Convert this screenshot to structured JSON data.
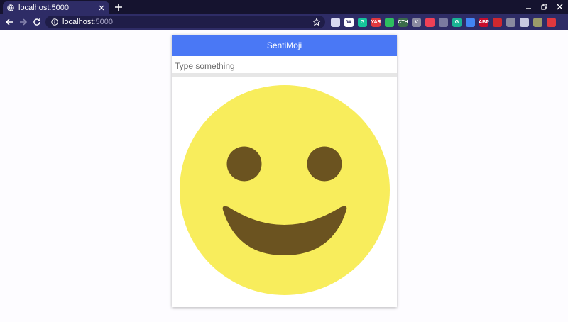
{
  "browser": {
    "tab": {
      "title": "localhost:5000"
    },
    "address": {
      "host": "localhost",
      "port": ":5000"
    },
    "extensions": [
      {
        "icon": "circle-ext-icon",
        "label": "",
        "color": "#d9d9f0"
      },
      {
        "icon": "w-ext-icon",
        "label": "W",
        "color": "#ffffff"
      },
      {
        "icon": "grammarly-ext-icon",
        "label": "G",
        "color": "#15c39a"
      },
      {
        "icon": "yar-ext-icon",
        "label": "YAR",
        "color": "#e0383e"
      },
      {
        "icon": "evernote-ext-icon",
        "label": "",
        "color": "#2dbe60"
      },
      {
        "icon": "cth-ext-icon",
        "label": "CTH",
        "color": "#3a6b4a"
      },
      {
        "icon": "v-ext-icon",
        "label": "V",
        "color": "#8a8aa0"
      },
      {
        "icon": "pocket-ext-icon",
        "label": "",
        "color": "#ef4056"
      },
      {
        "icon": "cast-ext-icon",
        "label": "",
        "color": "#7a7aa0"
      },
      {
        "icon": "translate-ext-icon",
        "label": "G",
        "color": "#1ab394"
      },
      {
        "icon": "refresh-ext-icon",
        "label": "",
        "color": "#4285f4"
      },
      {
        "icon": "abp-ext-icon",
        "label": "ABP",
        "color": "#c70d2c"
      },
      {
        "icon": "pdf-ext-icon",
        "label": "",
        "color": "#d0282f"
      },
      {
        "icon": "screenshot-ext-icon",
        "label": "",
        "color": "#8a8aa0"
      },
      {
        "icon": "puzzle-ext-icon",
        "label": "",
        "color": "#c8c8e0"
      },
      {
        "icon": "avatar-ext-icon",
        "label": "",
        "color": "#9b9b6a"
      },
      {
        "icon": "red-ext-icon",
        "label": "",
        "color": "#e0383e"
      }
    ]
  },
  "app": {
    "title": "SentiMoji",
    "input": {
      "placeholder": "Type something",
      "value": ""
    },
    "emoji": {
      "expression": "happy",
      "face_color": "#f8ed5c",
      "feature_color": "#6b5320"
    }
  },
  "colors": {
    "header": "#4a78f5",
    "tabbar": "#15132f",
    "toolbar": "#2e2c66"
  }
}
